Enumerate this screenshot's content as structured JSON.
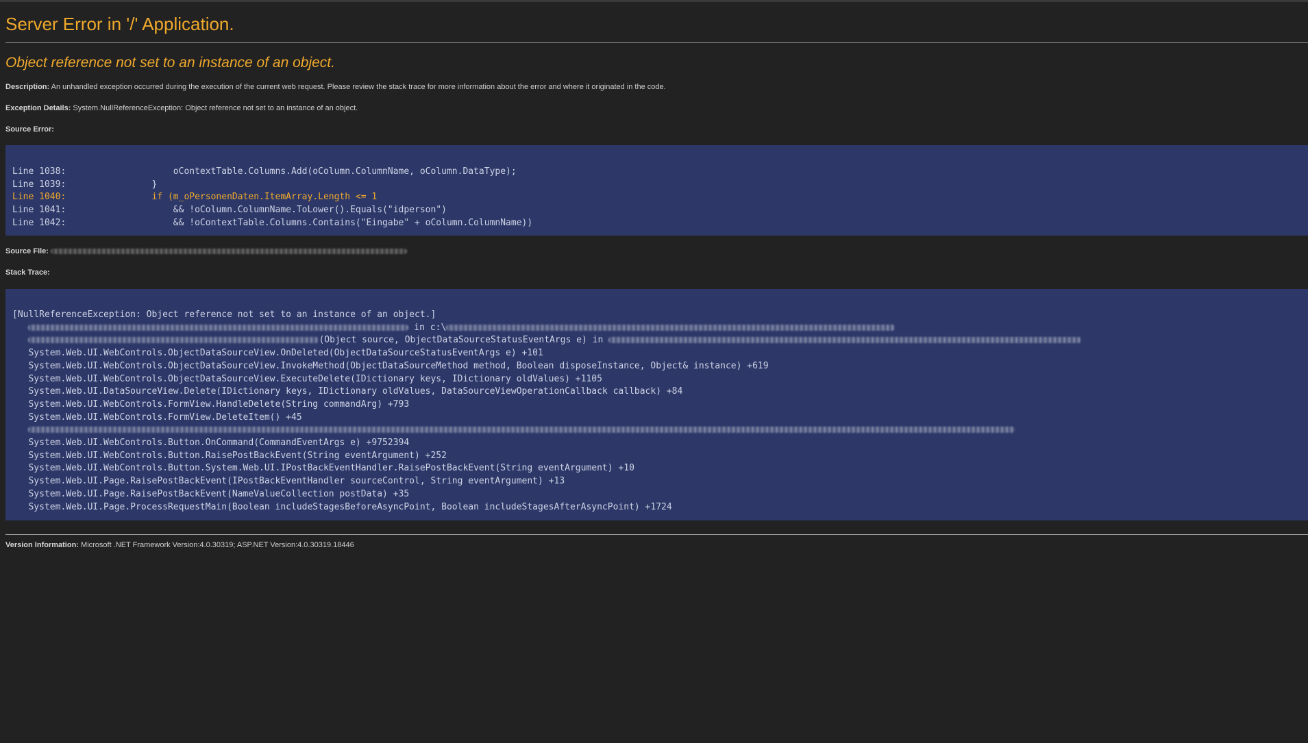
{
  "header": {
    "title": "Server Error in '/' Application.",
    "exception_message": "Object reference not set to an instance of an object."
  },
  "description": {
    "label": "Description:",
    "text": "An unhandled exception occurred during the execution of the current web request. Please review the stack trace for more information about the error and where it originated in the code."
  },
  "exception_details": {
    "label": "Exception Details:",
    "text": "System.NullReferenceException: Object reference not set to an instance of an object."
  },
  "source_error": {
    "label": "Source Error:",
    "lines": [
      {
        "text": "Line 1038:                    oContextTable.Columns.Add(oColumn.ColumnName, oColumn.DataType);"
      },
      {
        "text": "Line 1039:                }"
      },
      {
        "text": "Line 1040:                if (m_oPersonenDaten.ItemArray.Length <= 1"
      },
      {
        "text": "Line 1041:                    && !oColumn.ColumnName.ToLower().Equals(\"idperson\")"
      },
      {
        "text": "Line 1042:                    && !oContextTable.Columns.Contains(\"Eingabe\" + oColumn.ColumnName))"
      }
    ]
  },
  "source_file": {
    "label": "Source File:"
  },
  "stack_trace": {
    "label": "Stack Trace:",
    "exception_line": "[NullReferenceException: Object reference not set to an instance of an object.]",
    "line2_mid": " in c:\\",
    "line3_mid": "(Object source, ObjectDataSourceStatusEventArgs e) in ",
    "lines_a": [
      "   System.Web.UI.WebControls.ObjectDataSourceView.OnDeleted(ObjectDataSourceStatusEventArgs e) +101",
      "   System.Web.UI.WebControls.ObjectDataSourceView.InvokeMethod(ObjectDataSourceMethod method, Boolean disposeInstance, Object& instance) +619",
      "   System.Web.UI.WebControls.ObjectDataSourceView.ExecuteDelete(IDictionary keys, IDictionary oldValues) +1105",
      "   System.Web.UI.DataSourceView.Delete(IDictionary keys, IDictionary oldValues, DataSourceViewOperationCallback callback) +84",
      "   System.Web.UI.WebControls.FormView.HandleDelete(String commandArg) +793",
      "   System.Web.UI.WebControls.FormView.DeleteItem() +45"
    ],
    "lines_b": [
      "   System.Web.UI.WebControls.Button.OnCommand(CommandEventArgs e) +9752394",
      "   System.Web.UI.WebControls.Button.RaisePostBackEvent(String eventArgument) +252",
      "   System.Web.UI.WebControls.Button.System.Web.UI.IPostBackEventHandler.RaisePostBackEvent(String eventArgument) +10",
      "   System.Web.UI.Page.RaisePostBackEvent(IPostBackEventHandler sourceControl, String eventArgument) +13",
      "   System.Web.UI.Page.RaisePostBackEvent(NameValueCollection postData) +35",
      "   System.Web.UI.Page.ProcessRequestMain(Boolean includeStagesBeforeAsyncPoint, Boolean includeStagesAfterAsyncPoint) +1724"
    ]
  },
  "version_info": {
    "label": "Version Information:",
    "text": "Microsoft .NET Framework Version:4.0.30319; ASP.NET Version:4.0.30319.18446"
  },
  "colors": {
    "background": "#222222",
    "accent": "#f0a92c",
    "code_background": "#2d3868",
    "text": "#cfcfcf"
  }
}
